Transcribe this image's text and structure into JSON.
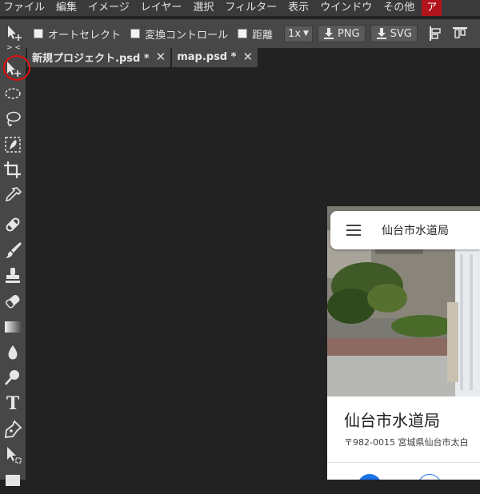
{
  "menu": {
    "items": [
      "ファイル",
      "編集",
      "イメージ",
      "レイヤー",
      "選択",
      "フィルター",
      "表示",
      "ウインドウ",
      "その他"
    ],
    "account_partial": "ア"
  },
  "options": {
    "auto_select_label": "オートセレクト",
    "transform_label": "変換コントロール",
    "distance_label": "距離",
    "zoom_value": "1x",
    "png_label": "PNG",
    "svg_label": "SVG"
  },
  "tabs": [
    {
      "label": "新規プロジェクト.psd *",
      "close": "✕"
    },
    {
      "label": "map.psd *",
      "close": "✕"
    }
  ],
  "toolbar": {
    "collapse_glyph": "> <",
    "text_tool_glyph": "T"
  },
  "map": {
    "search_text": "仙台市水道局",
    "place_name": "仙台市水道局",
    "address": "〒982-0015 宮城県仙台市太白"
  },
  "colors": {
    "accent": "#b0141c",
    "highlight_circle": "#e10f10",
    "map_blue": "#1a73e8"
  }
}
